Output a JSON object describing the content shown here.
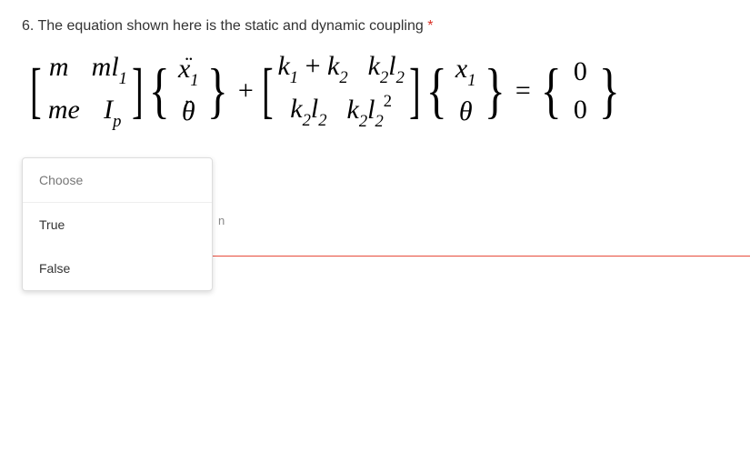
{
  "question": {
    "number": "6.",
    "text": "The equation shown here is the static and dynamic coupling",
    "required": "*"
  },
  "equation": {
    "massMatrix": {
      "r1c1": "m",
      "r1c2_a": "ml",
      "r1c2_sub": "1",
      "r2c1": "me",
      "r2c2_a": "I",
      "r2c2_sub": "p"
    },
    "accelVec": {
      "r1_a": "x",
      "r1_sub": "1",
      "r2": "θ"
    },
    "plus": "+",
    "stiffMatrix": {
      "r1c1_a": "k",
      "r1c1_s1": "1",
      "r1c1_op": " + ",
      "r1c1_b": "k",
      "r1c1_s2": "2",
      "r1c2_a": "k",
      "r1c2_s1": "2",
      "r1c2_b": "l",
      "r1c2_s2": "2",
      "r2c1_a": "k",
      "r2c1_s1": "2",
      "r2c1_b": "l",
      "r2c1_s2": "2",
      "r2c2_a": "k",
      "r2c2_s1": "2",
      "r2c2_b": "l",
      "r2c2_s2": "2",
      "r2c2_sup": "2"
    },
    "dispVec": {
      "r1_a": "x",
      "r1_sub": "1",
      "r2": "θ"
    },
    "eq": "=",
    "zeroVec": {
      "r1": "0",
      "r2": "0"
    }
  },
  "dropdown": {
    "placeholder": "Choose",
    "opt1": "True",
    "opt2": "False"
  },
  "stray": "n"
}
